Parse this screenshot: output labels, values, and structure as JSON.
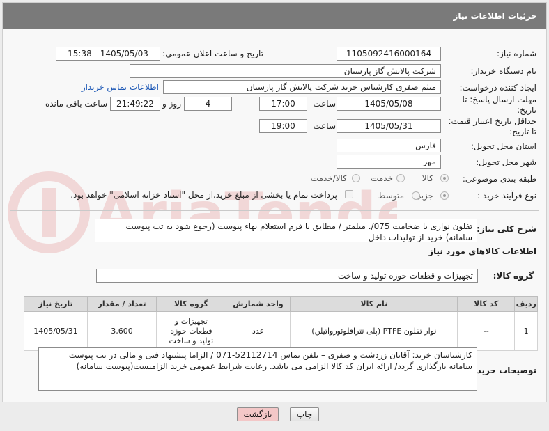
{
  "header": {
    "title": "جزئیات اطلاعات نیاز"
  },
  "form": {
    "need_number_label": "شماره نیاز:",
    "need_number": "1105092416000164",
    "announce_label": "تاریخ و ساعت اعلان عمومی:",
    "announce_value": "1405/05/03 - 15:38",
    "buyer_org_label": "نام دستگاه خریدار:",
    "buyer_org": "شرکت پالایش گاز پارسیان",
    "creator_label": "ایجاد کننده درخواست:",
    "creator": "میثم صفری کارشناس خرید شرکت پالایش گاز پارسیان",
    "contact_link": "اطلاعات تماس خریدار",
    "deadline_label_1": "مهلت ارسال پاسخ: تا",
    "deadline_label_2": "تاریخ:",
    "deadline_date": "1405/05/08",
    "time_label": "ساعت",
    "deadline_time": "17:00",
    "days_value": "4",
    "days_label": "روز و",
    "remaining_value": "21:49:22",
    "remaining_label": "ساعت باقی مانده",
    "validity_label_1": "حداقل تاریخ اعتبار قیمت:",
    "validity_label_2": "تا تاریخ:",
    "validity_date": "1405/05/31",
    "validity_time": "19:00",
    "province_label": "استان محل تحویل:",
    "province": "فارس",
    "city_label": "شهر محل تحویل:",
    "city": "مهر",
    "category_label": "طبقه بندی موضوعی:",
    "category_options": [
      "کالا",
      "خدمت",
      "کالا/خدمت"
    ],
    "category_selected": "کالا",
    "process_label": "نوع فرآیند خرید :",
    "process_options": [
      "جزیی",
      "متوسط"
    ],
    "process_selected": "جزیی",
    "payment_note": "پرداخت تمام یا بخشی از مبلغ خرید،از محل \"اسناد خزانه اسلامی\" خواهد بود."
  },
  "description": {
    "label": "شرح کلی نیاز:",
    "text": "تفلون نواری با ضخامت 075/. میلمتر / مطابق با فرم استعلام بهاء پیوست (رجوع شود به تب پیوست سامانه) خرید از تولیدات داخل"
  },
  "goods": {
    "section_title": "اطلاعات کالاهای مورد نیاز",
    "group_label": "گروه کالا:",
    "group_value": "تجهیزات و قطعات حوزه تولید و ساخت",
    "columns": [
      "ردیف",
      "کد کالا",
      "نام کالا",
      "واحد شمارش",
      "گروه کالا",
      "تعداد / مقدار",
      "تاریخ نیاز"
    ],
    "rows": [
      {
        "row": "1",
        "code": "--",
        "name": "نوار تفلون PTFE (پلی تترافلوئورواتیلن)",
        "unit": "عدد",
        "group": "تجهیزات و قطعات حوزه تولید و ساخت",
        "qty": "3,600",
        "date": "1405/05/31"
      }
    ]
  },
  "buyer_notes": {
    "label": "توضیحات خریدار:",
    "text": "کارشناسان خرید: آقایان زردشت و صفری – تلفن تماس 52112714-071 / الزاما پیشنهاد فنی و مالی در تب پیوست سامانه بارگذاری گردد/ ارائه ایران کد کالا الزامی می باشد. رعایت شرایط عمومی خرید الزامیست(پیوست سامانه)"
  },
  "buttons": {
    "print": "چاپ",
    "back": "بازگشت"
  },
  "colors": {
    "titlebar": "#7a7a7a",
    "link": "#1a56b5",
    "back_button_bg": "#f3c7c7"
  }
}
